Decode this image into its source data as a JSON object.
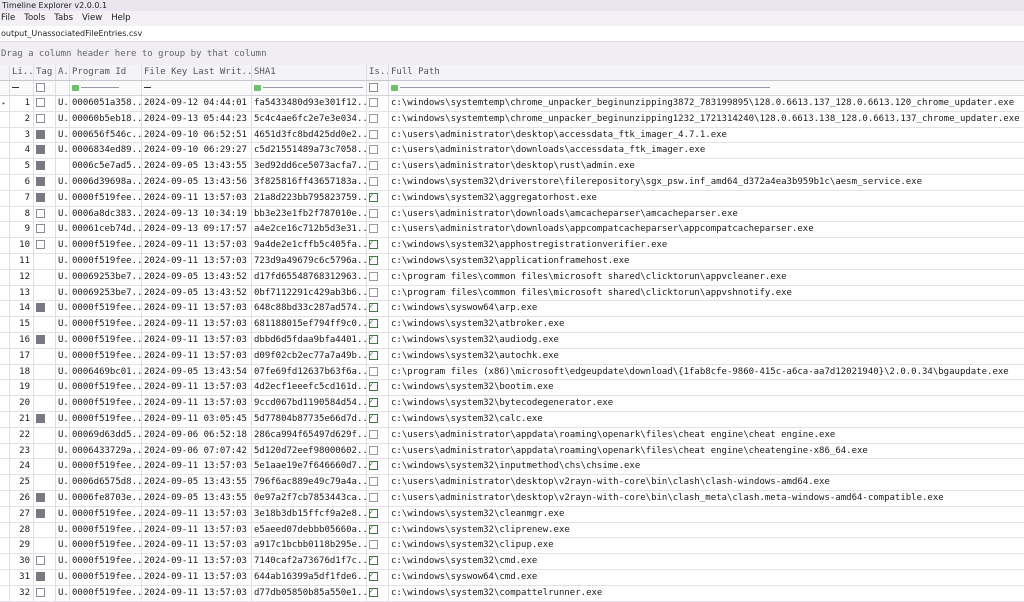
{
  "window": {
    "title": "Timeline Explorer v2.0.0.1"
  },
  "menu": [
    "File",
    "Tools",
    "Tabs",
    "View",
    "Help"
  ],
  "tab": {
    "label": "output_UnassociatedFileEntries.csv"
  },
  "group_panel": {
    "text": "Drag a column header here to group by that column"
  },
  "columns": {
    "line": "Li...",
    "tag": "Tag",
    "a": "A...",
    "program_id": "Program Id",
    "file_key_last_write": "File Key Last Writ...",
    "sha1": "SHA1",
    "is": "Is...",
    "full_path": "Full Path"
  },
  "rows": [
    {
      "line": "1",
      "tag": "unchecked",
      "a": "U...",
      "program_id": "0006051a358...",
      "time": "2024-09-12 04:44:01",
      "sha1": "fa5433480d93e301f12...",
      "is": false,
      "path": "c:\\windows\\systemtemp\\chrome_unpacker_beginunzipping3872_783199895\\128.0.6613.137_128.0.6613.120_chrome_updater.exe"
    },
    {
      "line": "2",
      "tag": "unchecked",
      "a": "U...",
      "program_id": "00060b5eb18...",
      "time": "2024-09-13 05:44:23",
      "sha1": "5c4c4ae6fc2e7e3e034...",
      "is": false,
      "path": "c:\\windows\\systemtemp\\chrome_unpacker_beginunzipping1232_1721314240\\128.0.6613.138_128.0.6613.137_chrome_updater.exe"
    },
    {
      "line": "3",
      "tag": "checked",
      "a": "U...",
      "program_id": "000656f546c...",
      "time": "2024-09-10 06:52:51",
      "sha1": "4651d3fc8bd425dd0e2...",
      "is": false,
      "path": "c:\\users\\administrator\\desktop\\accessdata_ftk_imager_4.7.1.exe"
    },
    {
      "line": "4",
      "tag": "checked",
      "a": "U...",
      "program_id": "0006834ed89...",
      "time": "2024-09-10 06:29:27",
      "sha1": "c5d21551489a73c7058...",
      "is": false,
      "path": "c:\\users\\administrator\\downloads\\accessdata_ftk_imager.exe"
    },
    {
      "line": "5",
      "tag": "checked",
      "a": "",
      "program_id": "0006c5e7ad5...",
      "time": "2024-09-05 13:43:55",
      "sha1": "3ed92dd6ce5073acfa7...",
      "is": false,
      "path": "c:\\users\\administrator\\desktop\\rust\\admin.exe"
    },
    {
      "line": "6",
      "tag": "checked",
      "a": "U...",
      "program_id": "0006d39698a...",
      "time": "2024-09-05 13:43:56",
      "sha1": "3f825816ff43657183a...",
      "is": false,
      "path": "c:\\windows\\system32\\driverstore\\filerepository\\sgx_psw.inf_amd64_d372a4ea3b959b1c\\aesm_service.exe"
    },
    {
      "line": "7",
      "tag": "checked",
      "a": "U...",
      "program_id": "0000f519fee...",
      "time": "2024-09-11 13:57:03",
      "sha1": "21a8d223bb795823759...",
      "is": true,
      "path": "c:\\windows\\system32\\aggregatorhost.exe"
    },
    {
      "line": "8",
      "tag": "unchecked",
      "a": "U...",
      "program_id": "0006a8dc383...",
      "time": "2024-09-13 10:34:19",
      "sha1": "bb3e23e1fb2f787010e...",
      "is": false,
      "path": "c:\\users\\administrator\\downloads\\amcacheparser\\amcacheparser.exe"
    },
    {
      "line": "9",
      "tag": "unchecked",
      "a": "U...",
      "program_id": "00061ceb74d...",
      "time": "2024-09-13 09:17:57",
      "sha1": "a4e2ce16c712b5d3e31...",
      "is": false,
      "path": "c:\\users\\administrator\\downloads\\appcompatcacheparser\\appcompatcacheparser.exe"
    },
    {
      "line": "10",
      "tag": "unchecked",
      "a": "U...",
      "program_id": "0000f519fee...",
      "time": "2024-09-11 13:57:03",
      "sha1": "9a4de2e1cffb5c405fa...",
      "is": true,
      "path": "c:\\windows\\system32\\apphostregistrationverifier.exe"
    },
    {
      "line": "11",
      "tag": "none",
      "a": "U...",
      "program_id": "0000f519fee...",
      "time": "2024-09-11 13:57:03",
      "sha1": "723d9a49679c6c5796a...",
      "is": true,
      "path": "c:\\windows\\system32\\applicationframehost.exe"
    },
    {
      "line": "12",
      "tag": "none",
      "a": "U...",
      "program_id": "00069253be7...",
      "time": "2024-09-05 13:43:52",
      "sha1": "d17fd65548768312963...",
      "is": false,
      "path": "c:\\program files\\common files\\microsoft shared\\clicktorun\\appvcleaner.exe"
    },
    {
      "line": "13",
      "tag": "none",
      "a": "U...",
      "program_id": "00069253be7...",
      "time": "2024-09-05 13:43:52",
      "sha1": "0bf7112291c429ab3b6...",
      "is": false,
      "path": "c:\\program files\\common files\\microsoft shared\\clicktorun\\appvshnotify.exe"
    },
    {
      "line": "14",
      "tag": "checked",
      "a": "U...",
      "program_id": "0000f519fee...",
      "time": "2024-09-11 13:57:03",
      "sha1": "648c88bd33c287ad574...",
      "is": true,
      "path": "c:\\windows\\syswow64\\arp.exe"
    },
    {
      "line": "15",
      "tag": "none",
      "a": "U...",
      "program_id": "0000f519fee...",
      "time": "2024-09-11 13:57:03",
      "sha1": "681188015ef794ff9c0...",
      "is": true,
      "path": "c:\\windows\\system32\\atbroker.exe"
    },
    {
      "line": "16",
      "tag": "checked",
      "a": "U...",
      "program_id": "0000f519fee...",
      "time": "2024-09-11 13:57:03",
      "sha1": "dbbd6d5fdaa9bfa4401...",
      "is": true,
      "path": "c:\\windows\\system32\\audiodg.exe"
    },
    {
      "line": "17",
      "tag": "none",
      "a": "U...",
      "program_id": "0000f519fee...",
      "time": "2024-09-11 13:57:03",
      "sha1": "d09f02cb2ec77a7a49b...",
      "is": true,
      "path": "c:\\windows\\system32\\autochk.exe"
    },
    {
      "line": "18",
      "tag": "none",
      "a": "U...",
      "program_id": "0006469bc01...",
      "time": "2024-09-05 13:43:54",
      "sha1": "07fe69fd12637b63f6a...",
      "is": false,
      "path": "c:\\program files (x86)\\microsoft\\edgeupdate\\download\\{1fab8cfe-9860-415c-a6ca-aa7d12021940}\\2.0.0.34\\bgaupdate.exe"
    },
    {
      "line": "19",
      "tag": "none",
      "a": "U...",
      "program_id": "0000f519fee...",
      "time": "2024-09-11 13:57:03",
      "sha1": "4d2ecf1eeefc5cd161d...",
      "is": true,
      "path": "c:\\windows\\system32\\bootim.exe"
    },
    {
      "line": "20",
      "tag": "none",
      "a": "U...",
      "program_id": "0000f519fee...",
      "time": "2024-09-11 13:57:03",
      "sha1": "9ccd067bd1190584d54...",
      "is": true,
      "path": "c:\\windows\\system32\\bytecodegenerator.exe"
    },
    {
      "line": "21",
      "tag": "checked",
      "a": "U...",
      "program_id": "0000f519fee...",
      "time": "2024-09-11 03:05:45",
      "sha1": "5d77804b87735e66d7d...",
      "is": true,
      "path": "c:\\windows\\system32\\calc.exe"
    },
    {
      "line": "22",
      "tag": "none",
      "a": "U...",
      "program_id": "00069d63dd5...",
      "time": "2024-09-06 06:52:18",
      "sha1": "286ca994f65497d629f...",
      "is": false,
      "path": "c:\\users\\administrator\\appdata\\roaming\\openark\\files\\cheat engine\\cheat engine.exe"
    },
    {
      "line": "23",
      "tag": "none",
      "a": "U...",
      "program_id": "0006433729a...",
      "time": "2024-09-06 07:07:42",
      "sha1": "5d120d72eef98000602...",
      "is": false,
      "path": "c:\\users\\administrator\\appdata\\roaming\\openark\\files\\cheat engine\\cheatengine-x86_64.exe"
    },
    {
      "line": "24",
      "tag": "none",
      "a": "U...",
      "program_id": "0000f519fee...",
      "time": "2024-09-11 13:57:03",
      "sha1": "5e1aae19e7f646660d7...",
      "is": true,
      "path": "c:\\windows\\system32\\inputmethod\\chs\\chsime.exe"
    },
    {
      "line": "25",
      "tag": "none",
      "a": "U...",
      "program_id": "0006d6575d8...",
      "time": "2024-09-05 13:43:55",
      "sha1": "796f6ac889e49c79a4a...",
      "is": false,
      "path": "c:\\users\\administrator\\desktop\\v2rayn-with-core\\bin\\clash\\clash-windows-amd64.exe"
    },
    {
      "line": "26",
      "tag": "checked",
      "a": "U...",
      "program_id": "0006fe8703e...",
      "time": "2024-09-05 13:43:55",
      "sha1": "0e97a2f7cb7853443ca...",
      "is": false,
      "path": "c:\\users\\administrator\\desktop\\v2rayn-with-core\\bin\\clash_meta\\clash.meta-windows-amd64-compatible.exe"
    },
    {
      "line": "27",
      "tag": "checked",
      "a": "U...",
      "program_id": "0000f519fee...",
      "time": "2024-09-11 13:57:03",
      "sha1": "3e18b3db15ffcf9a2e8...",
      "is": true,
      "path": "c:\\windows\\system32\\cleanmgr.exe"
    },
    {
      "line": "28",
      "tag": "none",
      "a": "U...",
      "program_id": "0000f519fee...",
      "time": "2024-09-11 13:57:03",
      "sha1": "e5aeed07debbb05660a...",
      "is": true,
      "path": "c:\\windows\\system32\\cliprenew.exe"
    },
    {
      "line": "29",
      "tag": "none",
      "a": "U...",
      "program_id": "0000f519fee...",
      "time": "2024-09-11 13:57:03",
      "sha1": "a917c1bcbb0118b295e...",
      "is": false,
      "path": "c:\\windows\\system32\\clipup.exe"
    },
    {
      "line": "30",
      "tag": "unchecked",
      "a": "U...",
      "program_id": "0000f519fee...",
      "time": "2024-09-11 13:57:03",
      "sha1": "7140caf2a73676d1f7c...",
      "is": true,
      "path": "c:\\windows\\system32\\cmd.exe"
    },
    {
      "line": "31",
      "tag": "checked",
      "a": "U...",
      "program_id": "0000f519fee...",
      "time": "2024-09-11 13:57:03",
      "sha1": "644ab16399a5df1fde6...",
      "is": true,
      "path": "c:\\windows\\syswow64\\cmd.exe"
    },
    {
      "line": "32",
      "tag": "unchecked",
      "a": "U...",
      "program_id": "0000f519fee...",
      "time": "2024-09-11 13:57:03",
      "sha1": "d77db05850b85a550e1...",
      "is": true,
      "path": "c:\\windows\\system32\\compattelrunner.exe"
    }
  ]
}
